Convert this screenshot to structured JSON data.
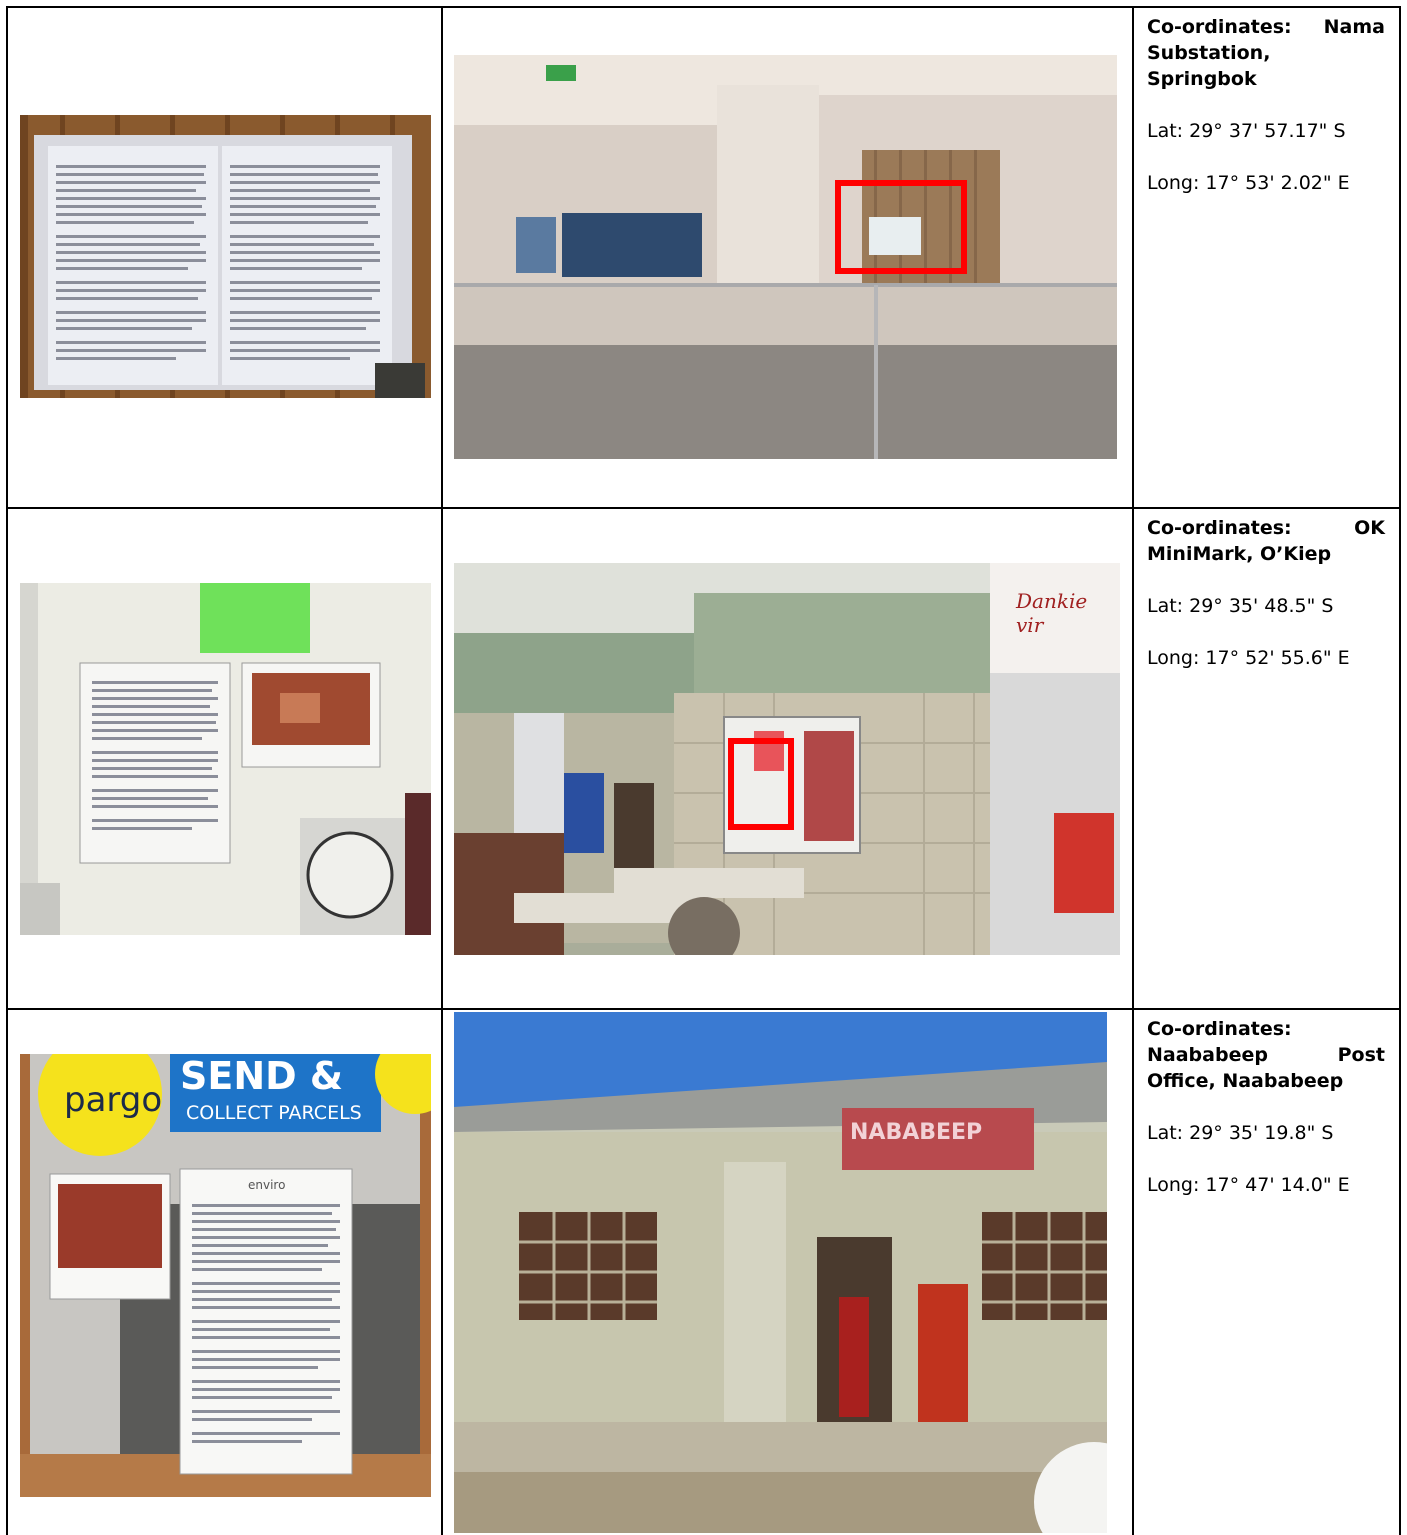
{
  "rows": [
    {
      "heading_line1": "Co-ordinates: Nama",
      "heading_rest": "Substation, Springbok",
      "lat": "Lat: 29° 37' 57.17\" S",
      "long": "Long: 17° 53' 2.02\" E",
      "left_photo": "Notice sheets posted on wooden door",
      "right_photo": "Nama Substation building entrance"
    },
    {
      "heading_line1": "Co-ordinates: OK",
      "heading_rest": "MiniMark, O’Kiep",
      "lat": "Lat: 29° 35' 48.5\" S",
      "long": "Long: 17° 52' 55.6\" E",
      "left_photo": "Notice and map on store notice board",
      "right_photo": "OK MiniMark interior with notice board",
      "store_sign": "Dankie vir"
    },
    {
      "heading_line1": "Co-ordinates:",
      "heading_line2": "Naababeep Post",
      "heading_rest": "Office, Naababeep",
      "lat": "Lat: 29° 35' 19.8\" S",
      "long": "Long: 17° 47' 14.0\" E",
      "left_photo": "Notice and map on Pargo board",
      "right_photo": "Naababeep Post Office building",
      "pargo_brand": "pargo",
      "pargo_send": "SEND &",
      "pargo_collect": "COLLECT PARCELS",
      "notice_brand": "enviro",
      "post_office_sign": "NABABEEP"
    }
  ]
}
